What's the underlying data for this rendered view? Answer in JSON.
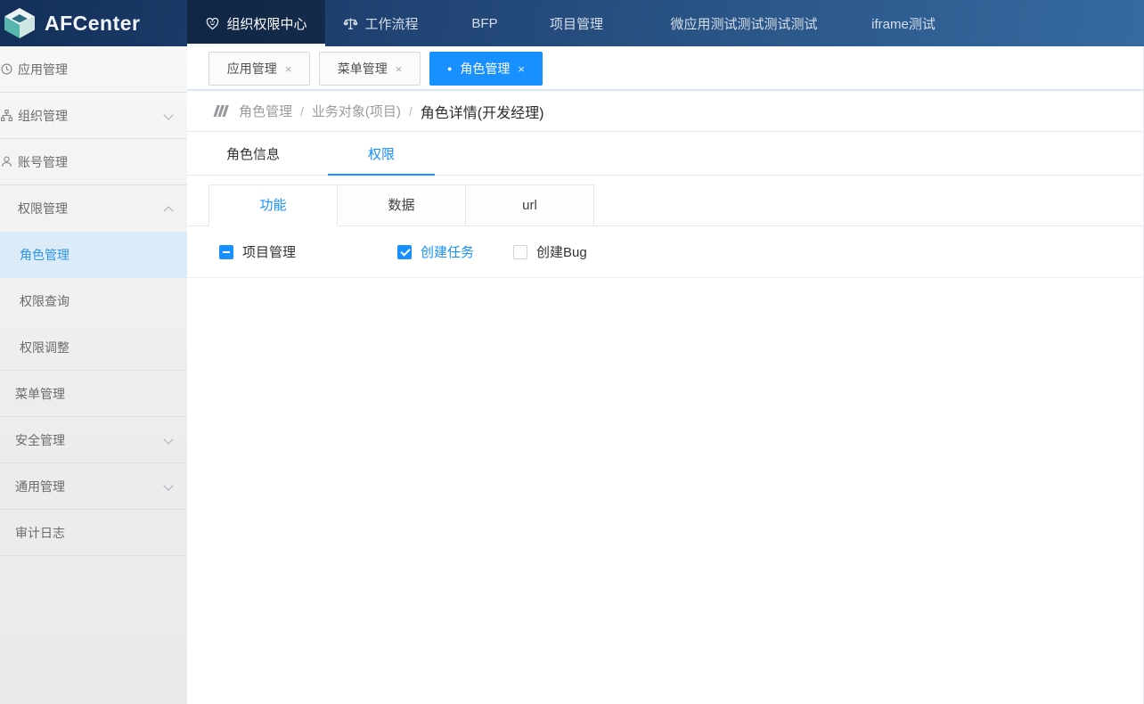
{
  "app": {
    "title": "AFCenter"
  },
  "navbar": {
    "items": [
      {
        "label": "组织权限中心",
        "icon": "heart-smile-icon",
        "active": true
      },
      {
        "label": "工作流程",
        "icon": "balance-scale-icon",
        "active": false
      },
      {
        "label": "BFP",
        "active": false
      },
      {
        "label": "项目管理",
        "active": false
      },
      {
        "label": "微应用测试测试测试测试",
        "active": false
      },
      {
        "label": "iframe测试",
        "active": false
      }
    ]
  },
  "sidebar": {
    "items": [
      {
        "label": "应用管理",
        "icon": "clock-icon"
      },
      {
        "label": "组织管理",
        "icon": "org-chart-icon",
        "chevron": "down"
      },
      {
        "label": "账号管理",
        "icon": "user-icon"
      },
      {
        "label": "权限管理",
        "chevron": "up",
        "expanded": true
      },
      {
        "label": "角色管理",
        "active": true
      },
      {
        "label": "权限查询"
      },
      {
        "label": "权限调整"
      },
      {
        "label": "菜单管理"
      },
      {
        "label": "安全管理",
        "chevron": "down"
      },
      {
        "label": "通用管理",
        "chevron": "down"
      },
      {
        "label": "审计日志"
      }
    ]
  },
  "tabbar": {
    "close_glyph": "×",
    "active_bullet": "●",
    "tabs": [
      {
        "label": "应用管理",
        "active": false
      },
      {
        "label": "菜单管理",
        "active": false
      },
      {
        "label": "角色管理",
        "active": true
      }
    ]
  },
  "breadcrumb": {
    "separator": "/",
    "items": [
      "角色管理",
      "业务对象(项目)",
      "角色详情(开发经理)"
    ]
  },
  "detail_tabs": [
    {
      "label": "角色信息",
      "active": false
    },
    {
      "label": "权限",
      "active": true
    }
  ],
  "perm_tabs": [
    {
      "label": "功能",
      "active": true
    },
    {
      "label": "数据",
      "active": false
    },
    {
      "label": "url",
      "active": false
    }
  ],
  "permissions": [
    {
      "label": "项目管理",
      "state": "indeterminate"
    },
    {
      "label": "创建任务",
      "state": "checked"
    },
    {
      "label": "创建Bug",
      "state": "unchecked"
    }
  ],
  "colors": {
    "accent": "#1890ff",
    "navbar_gradient_start": "#14305a",
    "navbar_gradient_end": "#356aa0",
    "sidebar_active_bg": "#dcebf8",
    "tabbar_underline": "#d9e7f5"
  }
}
